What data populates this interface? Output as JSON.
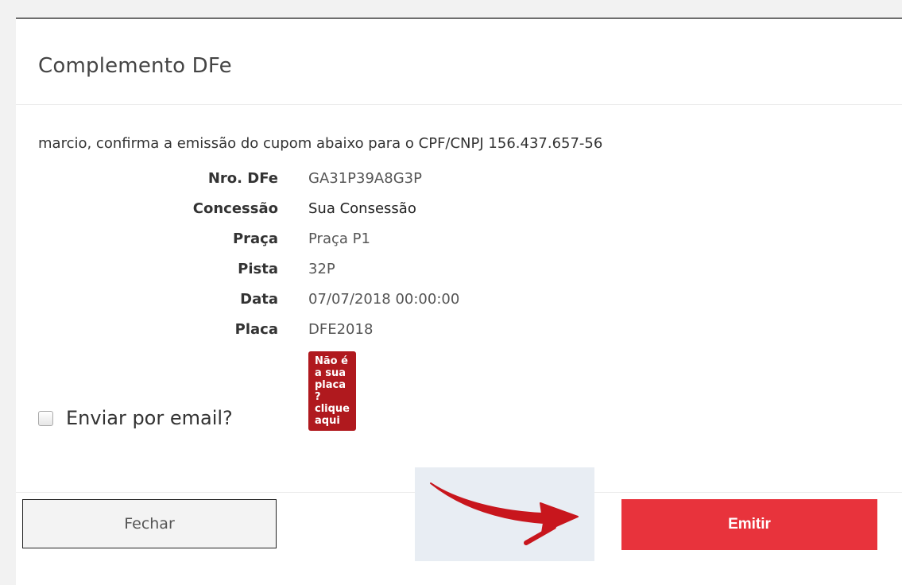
{
  "modal": {
    "title": "Complemento DFe",
    "intro": "marcio, confirma a emissão do cupom abaixo para o CPF/CNPJ 156.437.657-56",
    "details": [
      {
        "label": "Nro. DFe",
        "value": "GA31P39A8G3P"
      },
      {
        "label": "Concessão",
        "value": "Sua Consessão"
      },
      {
        "label": "Praça",
        "value": "Praça P1"
      },
      {
        "label": "Pista",
        "value": "32P"
      },
      {
        "label": "Data",
        "value": "07/07/2018 00:00:00"
      },
      {
        "label": "Placa",
        "value": "DFE2018"
      }
    ],
    "plate_link": "Não é a sua placa ? clique aqui",
    "email_checkbox": {
      "label": "Enviar por email?",
      "checked": false
    }
  },
  "footer": {
    "close_label": "Fechar",
    "emit_label": "Emitir"
  },
  "colors": {
    "emit_button": "#e8333c",
    "badge": "#b0191e",
    "arrow": "#c8161d"
  },
  "icons": {
    "annotation": "red-arrow-icon",
    "checkbox": "checkbox-icon"
  }
}
